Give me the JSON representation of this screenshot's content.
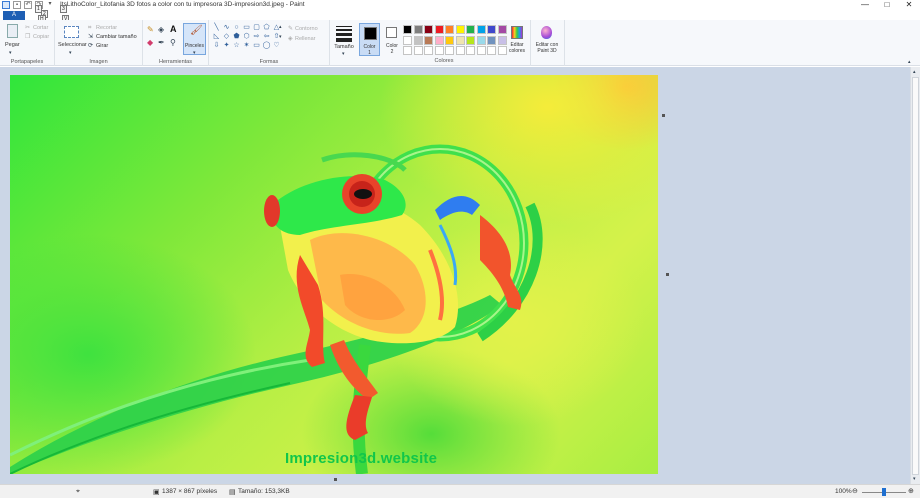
{
  "window": {
    "title": "ItsLithoColor_Litofania 3D fotos a color con tu impresora 3D-impresion3d.jpeg - Paint",
    "minimize": "—",
    "maximize": "□",
    "close": "✕"
  },
  "quick_access": {
    "save": "",
    "undo": "",
    "redo": ""
  },
  "tabs": {
    "file": "A",
    "keytips": [
      "1",
      "2",
      "3",
      "H",
      "V"
    ]
  },
  "ribbon": {
    "portapapeles": {
      "label": "Portapapeles",
      "paste": "Pegar",
      "cut": "Cortar",
      "copy": "Copiar"
    },
    "imagen": {
      "label": "Imagen",
      "select": "Seleccionar",
      "crop": "Recortar",
      "resize": "Cambiar tamaño",
      "rotate": "Girar"
    },
    "herramientas": {
      "label": "Herramientas",
      "brushes": "Pinceles"
    },
    "formas": {
      "label": "Formas",
      "outline": "Contorno",
      "fill": "Rellenar"
    },
    "size": "Tamaño",
    "colores": {
      "label": "Colores",
      "color1": "Color 1",
      "color2": "Color 2",
      "edit_colors": "Editar colores",
      "paint3d": "Editar con Paint 3D",
      "palette": [
        "#000000",
        "#7f7f7f",
        "#880015",
        "#ed1c24",
        "#ff7f27",
        "#fff200",
        "#22b14c",
        "#00a2e8",
        "#3f48cc",
        "#a349a4",
        "#ffffff",
        "#c3c3c3",
        "#b97a57",
        "#ffaec9",
        "#ffc90e",
        "#efe4b0",
        "#b5e61d",
        "#99d9ea",
        "#7092be",
        "#c8bfe7",
        "#ffffff",
        "#ffffff",
        "#ffffff",
        "#ffffff",
        "#ffffff",
        "#ffffff",
        "#ffffff",
        "#ffffff",
        "#ffffff",
        "#ffffff"
      ]
    }
  },
  "canvas": {
    "watermark": "Impresion3d.website"
  },
  "status": {
    "dimensions": "1387 × 867 píxeles",
    "size": "Tamaño: 153,3KB",
    "zoom": "100%",
    "zoom_level": 1.0
  }
}
